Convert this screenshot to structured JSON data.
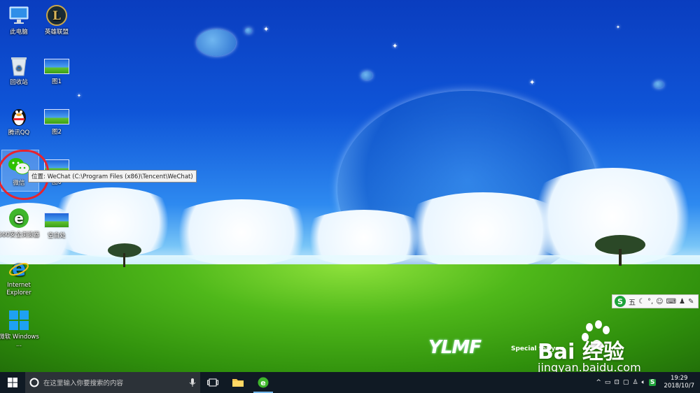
{
  "desktop_icons": [
    {
      "label": "此电脑"
    },
    {
      "label": "英雄联盟"
    },
    {
      "label": "回收站"
    },
    {
      "label": "图1"
    },
    {
      "label": "腾讯QQ"
    },
    {
      "label": "图2"
    },
    {
      "label": "微信"
    },
    {
      "label": "图0"
    },
    {
      "label": "360安全浏览器"
    },
    {
      "label": "空白处"
    },
    {
      "label": "Internet Explorer"
    },
    {
      "label": "微软 Windows ..."
    }
  ],
  "tooltip": {
    "text": "位置: WeChat (C:\\Program Files (x86)\\Tencent\\WeChat)"
  },
  "ime_bar": {
    "logo": "S",
    "mode": "五",
    "icons": [
      "moon-icon",
      "punctuation-icon",
      "emoji-icon",
      "keyboard-icon",
      "user-icon",
      "wrench-icon"
    ]
  },
  "watermark": {
    "brand": "YLMF",
    "brand_sub": "Special for you",
    "baidu": "Bai 经验",
    "url": "jingyan.baidu.com"
  },
  "taskbar": {
    "search_placeholder": "在这里输入你要搜索的内容",
    "clock_time": "19:29",
    "clock_date": "2018/10/7",
    "ime_indicator": "S"
  },
  "colors": {
    "taskbar_bg": "#101a24",
    "wechat_green": "#2dc100",
    "annotation_red": "#e8232d"
  }
}
